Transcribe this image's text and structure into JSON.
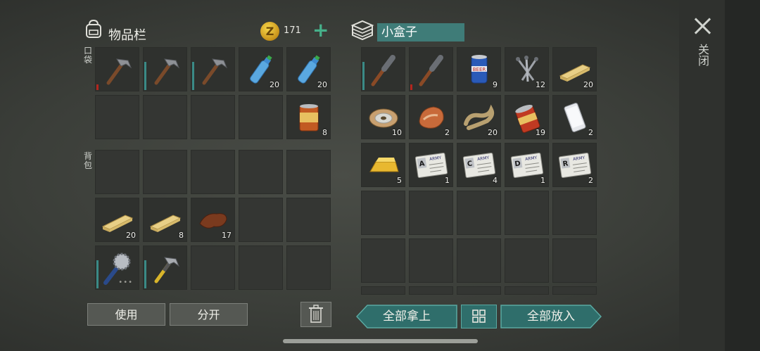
{
  "inventory": {
    "title": "物品栏",
    "coins": "171",
    "pocket_label": "口袋",
    "backpack_label": "背包",
    "pocket_slots": [
      {
        "icon": "hammer-icon",
        "qty": "",
        "dur": "red"
      },
      {
        "icon": "hammer-icon",
        "qty": "",
        "dur": "teal"
      },
      {
        "icon": "hammer-icon",
        "qty": "",
        "dur": "teal"
      },
      {
        "icon": "water-bottle-icon",
        "qty": "20",
        "dur": ""
      },
      {
        "icon": "water-bottle-icon",
        "qty": "20",
        "dur": ""
      },
      {
        "icon": "",
        "qty": "",
        "dur": ""
      },
      {
        "icon": "",
        "qty": "",
        "dur": ""
      },
      {
        "icon": "",
        "qty": "",
        "dur": ""
      },
      {
        "icon": "",
        "qty": "",
        "dur": ""
      },
      {
        "icon": "food-can-icon",
        "qty": "8",
        "dur": ""
      }
    ],
    "backpack_slots": [
      {
        "icon": "",
        "qty": "",
        "dur": ""
      },
      {
        "icon": "",
        "qty": "",
        "dur": ""
      },
      {
        "icon": "",
        "qty": "",
        "dur": ""
      },
      {
        "icon": "",
        "qty": "",
        "dur": ""
      },
      {
        "icon": "",
        "qty": "",
        "dur": ""
      },
      {
        "icon": "wood-plank-icon",
        "qty": "20",
        "dur": ""
      },
      {
        "icon": "wood-plank-icon",
        "qty": "8",
        "dur": ""
      },
      {
        "icon": "leather-icon",
        "qty": "17",
        "dur": ""
      },
      {
        "icon": "",
        "qty": "",
        "dur": ""
      },
      {
        "icon": "",
        "qty": "",
        "dur": ""
      },
      {
        "icon": "saw-mace-icon",
        "qty": "",
        "dur": "teal",
        "dots": true
      },
      {
        "icon": "hammer-yellow-icon",
        "qty": "",
        "dur": "teal"
      },
      {
        "icon": "",
        "qty": "",
        "dur": ""
      },
      {
        "icon": "",
        "qty": "",
        "dur": ""
      },
      {
        "icon": "",
        "qty": "",
        "dur": ""
      }
    ]
  },
  "container": {
    "name": "小盒子",
    "slots": [
      {
        "icon": "torch-bat-icon",
        "qty": "",
        "dur": "teal"
      },
      {
        "icon": "torch-bat-icon",
        "qty": "",
        "dur": "red"
      },
      {
        "icon": "beer-can-icon",
        "qty": "9",
        "dur": ""
      },
      {
        "icon": "nails-icon",
        "qty": "12",
        "dur": ""
      },
      {
        "icon": "wood-plank-icon",
        "qty": "20",
        "dur": ""
      },
      {
        "icon": "wire-spool-icon",
        "qty": "10",
        "dur": ""
      },
      {
        "icon": "meat-icon",
        "qty": "2",
        "dur": ""
      },
      {
        "icon": "rope-icon",
        "qty": "20",
        "dur": ""
      },
      {
        "icon": "open-can-icon",
        "qty": "19",
        "dur": ""
      },
      {
        "icon": "phone-icon",
        "qty": "2",
        "dur": ""
      },
      {
        "icon": "gold-bar-icon",
        "qty": "5",
        "dur": ""
      },
      {
        "icon": "army-card-a-icon",
        "qty": "1",
        "dur": "",
        "letter": "A"
      },
      {
        "icon": "army-card-c-icon",
        "qty": "4",
        "dur": "",
        "letter": "C"
      },
      {
        "icon": "army-card-d-icon",
        "qty": "1",
        "dur": "",
        "letter": "D"
      },
      {
        "icon": "army-card-r-icon",
        "qty": "2",
        "dur": "",
        "letter": "R"
      }
    ]
  },
  "buttons": {
    "use": "使用",
    "split": "分开",
    "take_all": "全部拿上",
    "put_all": "全部放入",
    "close": "关闭"
  },
  "colors": {
    "accent": "#3f7c78",
    "durability_red": "#b3261e",
    "durability_teal": "#3a8a86",
    "coin": "#e8b830"
  }
}
